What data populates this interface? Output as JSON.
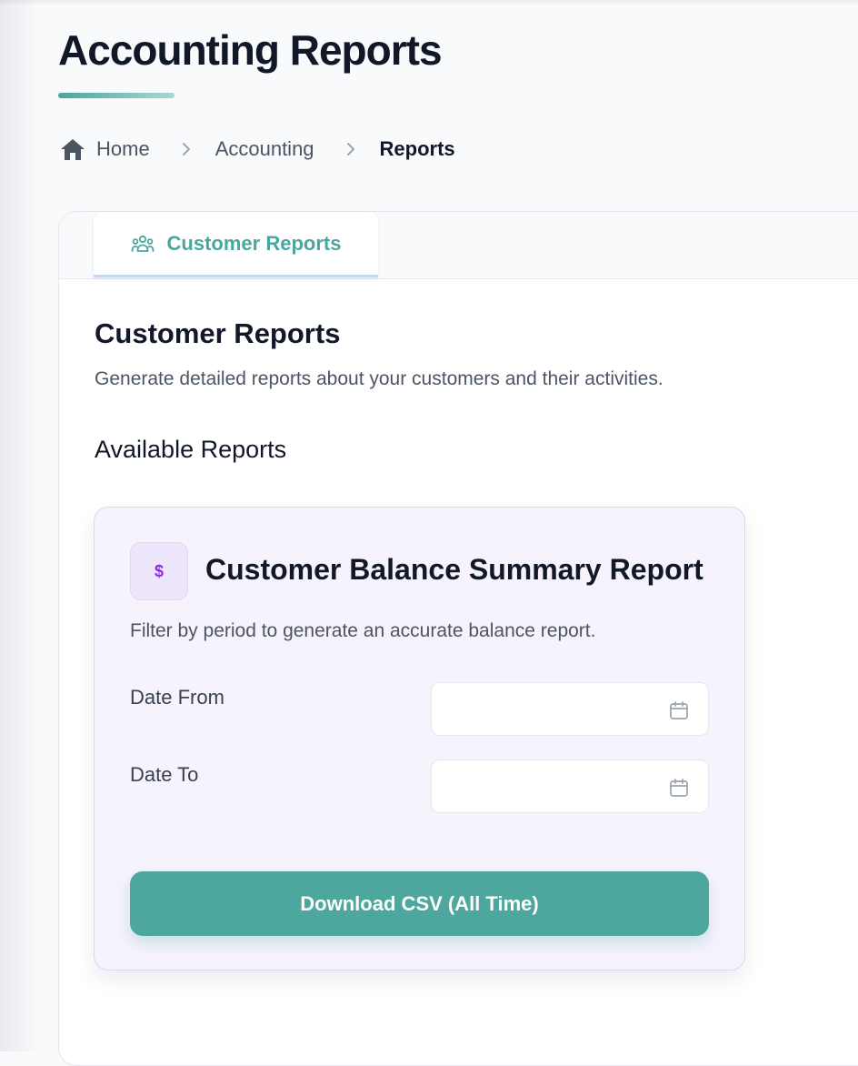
{
  "page": {
    "title": "Accounting Reports"
  },
  "breadcrumb": {
    "items": [
      {
        "label": "Home",
        "icon": "home-icon"
      },
      {
        "label": "Accounting"
      },
      {
        "label": "Reports"
      }
    ]
  },
  "tabs": [
    {
      "label": "Customer Reports",
      "icon": "users-icon",
      "active": true
    }
  ],
  "section": {
    "title": "Customer Reports",
    "description": "Generate detailed reports about your customers and their activities.",
    "subtitle": "Available Reports"
  },
  "report_card": {
    "icon": "dollar-icon",
    "icon_glyph": "$",
    "title": "Customer Balance Summary Report",
    "description": "Filter by period to generate an accurate balance report.",
    "fields": [
      {
        "label": "Date From",
        "value": "",
        "icon": "calendar-icon"
      },
      {
        "label": "Date To",
        "value": "",
        "icon": "calendar-icon"
      }
    ],
    "download_label": "Download CSV (All Time)"
  },
  "colors": {
    "accent": "#4ea79f",
    "card_bg": "#f6f3fd",
    "dollar_icon": "#8b2be2",
    "text_primary": "#111827",
    "text_secondary": "#4b5563"
  }
}
